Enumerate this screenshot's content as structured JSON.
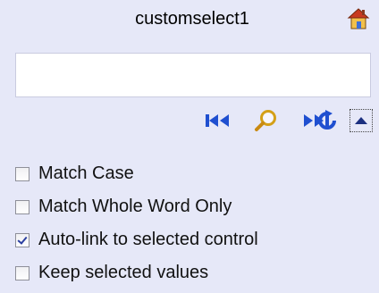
{
  "header": {
    "title": "customselect1",
    "home_icon": "home-icon"
  },
  "search": {
    "value": "",
    "placeholder": ""
  },
  "toolbar": {
    "buttons": [
      {
        "name": "first-icon"
      },
      {
        "name": "find-icon"
      },
      {
        "name": "last-icon"
      },
      {
        "name": "refresh-icon"
      },
      {
        "name": "collapse-icon"
      }
    ]
  },
  "options": [
    {
      "label": "Match Case",
      "checked": false
    },
    {
      "label": "Match Whole Word Only",
      "checked": false
    },
    {
      "label": "Auto-link to selected control",
      "checked": true
    },
    {
      "label": "Keep selected values",
      "checked": false
    }
  ],
  "colors": {
    "background": "#e6e8f8",
    "icon_blue": "#1f4fd0",
    "checkmark": "#2b3fa0"
  }
}
